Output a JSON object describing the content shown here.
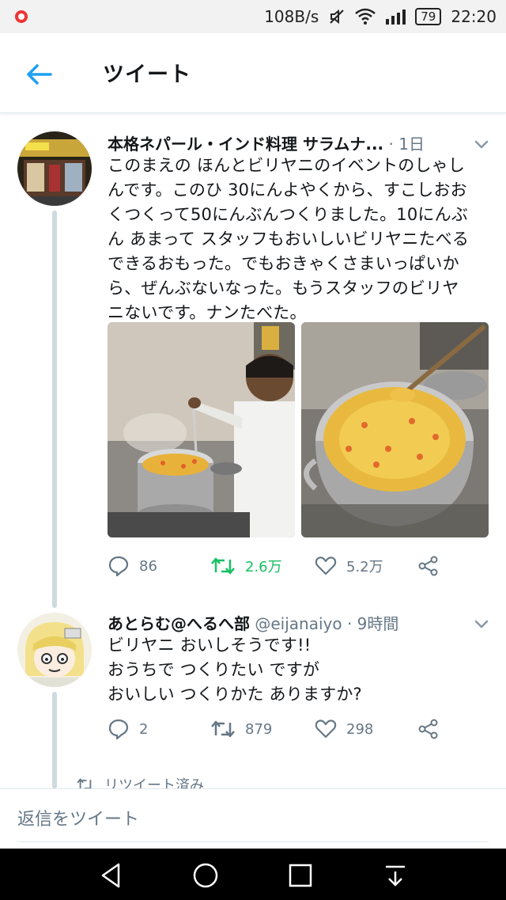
{
  "status_bar": {
    "speed": "108B/s",
    "battery": "79",
    "time": "22:20"
  },
  "header": {
    "title": "ツイート"
  },
  "tweet1": {
    "name": "本格ネパール・インド料理 サラムナ...",
    "meta": "· 1日",
    "text_lines": [
      "このまえの ほんとビリヤニのイベントのしゃし",
      "んです。このひ 30にんよやくから、すこしおお",
      "くつくって50にんぶんつくりました。10にんぶ",
      "ん あまって スタッフもおいしいビリヤニたべる",
      "できるおもった。でもおきゃくさまいっぱいか",
      "ら、ぜんぶないなった。もうスタッフのビリヤ",
      "ニないです。ナンたべた。"
    ],
    "replies": "86",
    "retweets": "2.6万",
    "likes": "5.2万"
  },
  "tweet2": {
    "name": "あとらむ@へるへ部",
    "handle": "@eijanaiyo",
    "meta": "· 9時間",
    "text_lines": [
      "ビリヤニ おいしそうです!!",
      "おうちで つくりたい ですが",
      "おいしい つくりかた ありますか?"
    ],
    "replies": "2",
    "retweets": "879",
    "likes": "298"
  },
  "retweeted_label": "リツイート済み",
  "reply_bar": {
    "placeholder": "返信をツイート"
  },
  "colors": {
    "accent": "#1da1f2",
    "retweet_green": "#17bf63",
    "muted": "#657786"
  }
}
